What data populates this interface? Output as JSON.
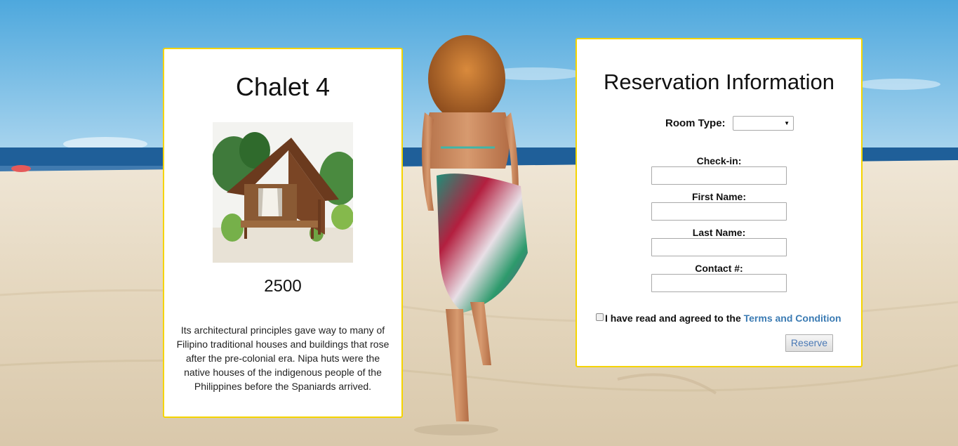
{
  "chalet": {
    "title": "Chalet 4",
    "price": "2500",
    "description": "Its architectural principles gave way to many of Filipino traditional houses and buildings that rose after the pre-colonial era. Nipa huts were the native houses of the indigenous people of the Philippines before the Spaniards arrived."
  },
  "reservation": {
    "title": "Reservation Information",
    "room_type_label": "Room Type:",
    "room_type_value": "",
    "checkin_label": "Check-in:",
    "checkin_value": "",
    "first_name_label": "First Name:",
    "first_name_value": "",
    "last_name_label": "Last Name:",
    "last_name_value": "",
    "contact_label": "Contact #:",
    "contact_value": "",
    "agree_text": "I have read and agreed to the ",
    "terms_link": "Terms and Condition",
    "reserve_button": "Reserve"
  },
  "colors": {
    "card_border": "#f5d400",
    "link": "#3b7bb3",
    "sky": "#5fb0e0",
    "sea": "#1f5f99",
    "sand": "#e8dcc6"
  },
  "icons": {
    "select_arrow": "dropdown-arrow-icon"
  }
}
